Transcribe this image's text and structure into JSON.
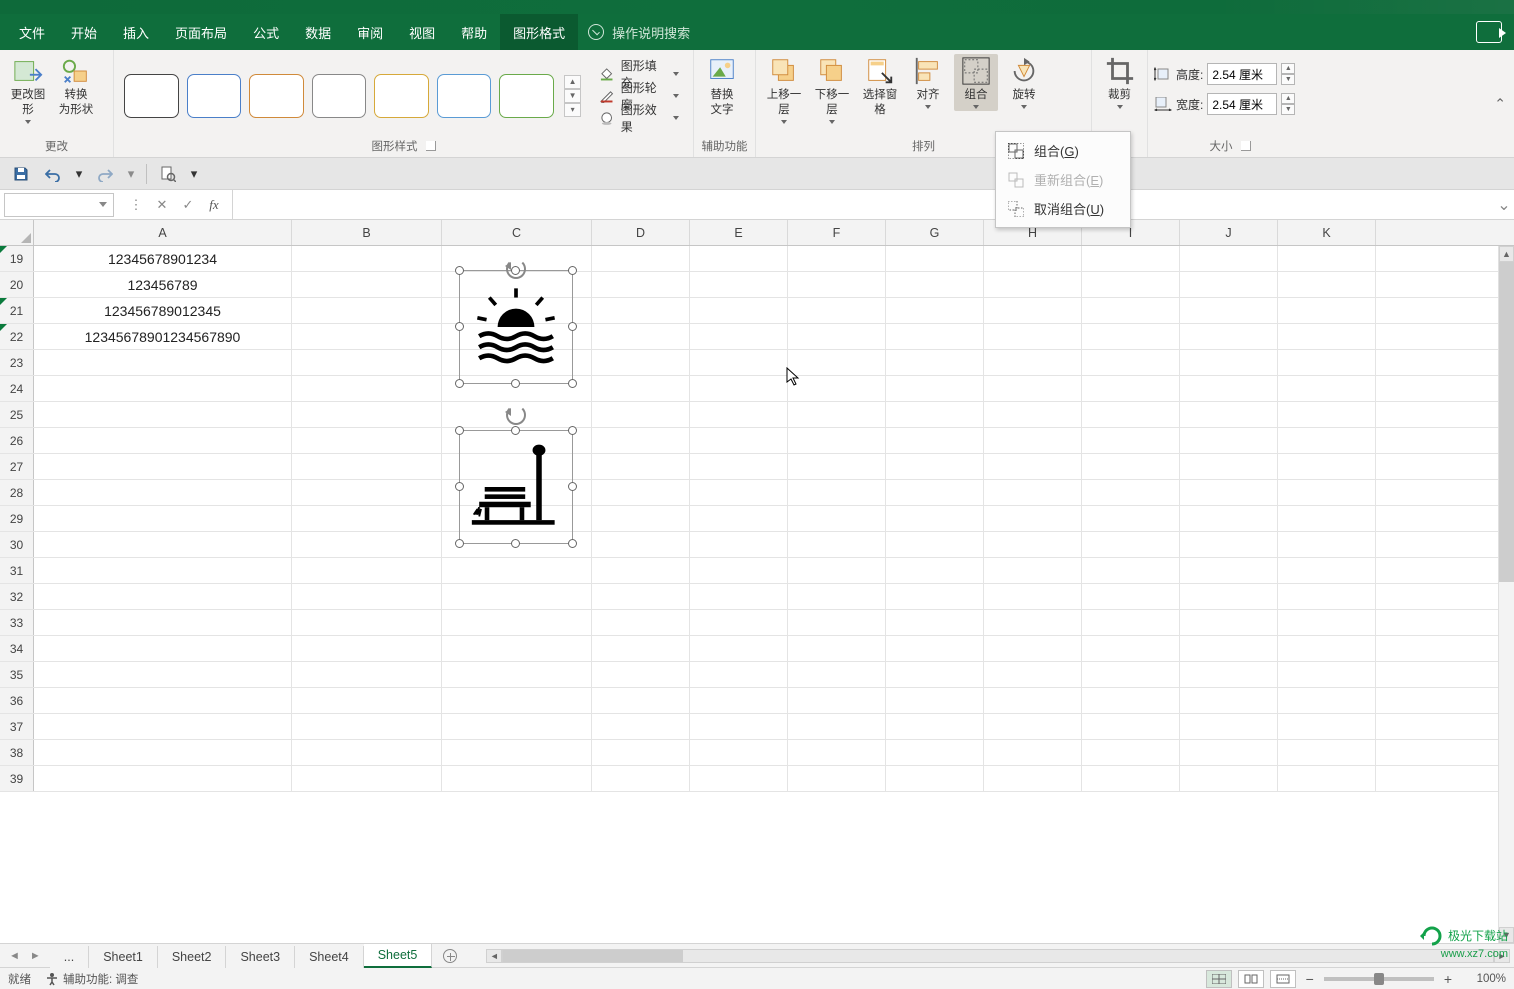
{
  "tabs": {
    "file": "文件",
    "home": "开始",
    "insert": "插入",
    "layout": "页面布局",
    "formula": "公式",
    "data": "数据",
    "review": "审阅",
    "view": "视图",
    "help": "帮助",
    "shape_format": "图形格式",
    "tell_me": "操作说明搜索"
  },
  "ribbon": {
    "change_group": {
      "change_shape": "更改图\n形",
      "convert_shape": "转换\n为形状",
      "label": "更改"
    },
    "style_group": {
      "label": "图形样式"
    },
    "style_extra": {
      "fill": "图形填充",
      "outline": "图形轮廓",
      "effects": "图形效果"
    },
    "alt_text": {
      "btn": "替换\n文字",
      "label": "辅助功能"
    },
    "arrange": {
      "bring_forward": "上移一层",
      "send_backward": "下移一层",
      "selection_pane": "选择窗格",
      "align": "对齐",
      "group": "组合",
      "rotate": "旋转",
      "label": "排列"
    },
    "crop": "裁剪",
    "size": {
      "height_label": "高度:",
      "height_value": "2.54 厘米",
      "width_label": "宽度:",
      "width_value": "2.54 厘米",
      "label": "大小"
    }
  },
  "dropdown": {
    "group": "组合(",
    "group_key": "G",
    "group_suffix": ")",
    "regroup": "重新组合(",
    "regroup_key": "E",
    "regroup_suffix": ")",
    "ungroup": "取消组合(",
    "ungroup_key": "U",
    "ungroup_suffix": ")"
  },
  "grid": {
    "columns": [
      "A",
      "B",
      "C",
      "D",
      "E",
      "F",
      "G",
      "H",
      "I",
      "J",
      "K"
    ],
    "row_start": 19,
    "row_end": 39,
    "cells": {
      "A19": "12345678901234",
      "A20": "123456789",
      "A21": "123456789012345",
      "A22": "12345678901234567890"
    },
    "err_rows": [
      19,
      21,
      22
    ]
  },
  "sheets": {
    "more": "...",
    "list": [
      "Sheet1",
      "Sheet2",
      "Sheet3",
      "Sheet4",
      "Sheet5"
    ],
    "active": "Sheet5"
  },
  "status": {
    "ready": "就绪",
    "accessibility": "辅助功能: 调查",
    "zoom": "100%"
  },
  "watermark": {
    "site": "极光下载站",
    "url": "www.xz7.com"
  }
}
